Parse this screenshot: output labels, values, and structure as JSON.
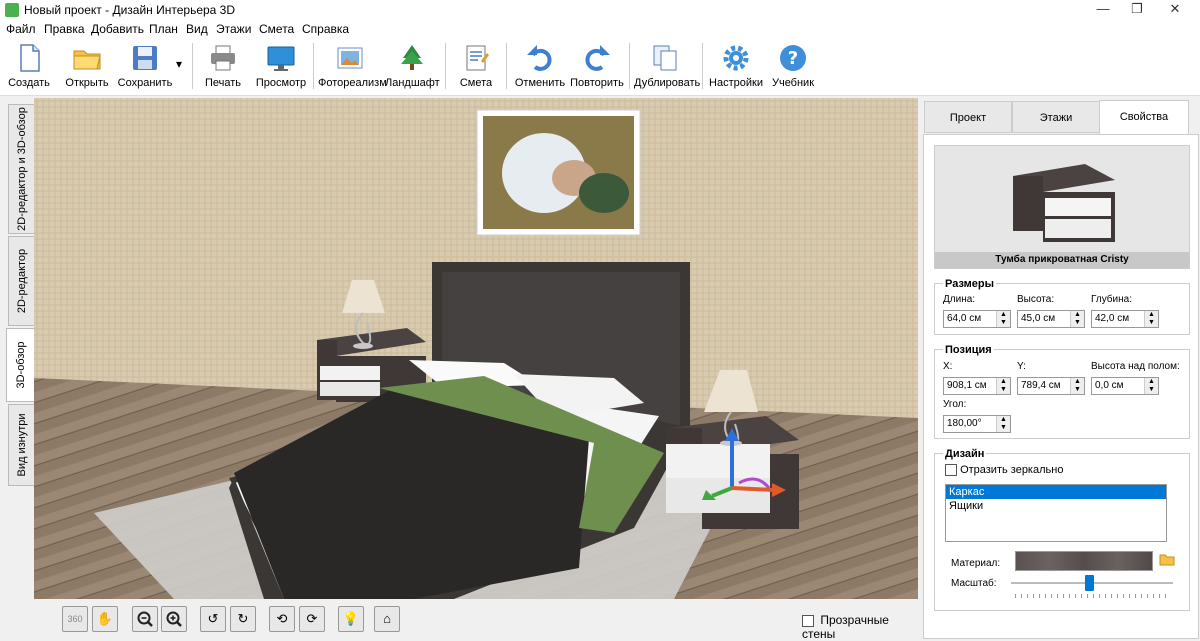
{
  "window": {
    "title": "Новый проект - Дизайн Интерьера 3D",
    "minimize": "—",
    "maximize": "❐",
    "close": "✕"
  },
  "menu": [
    "Файл",
    "Правка",
    "Добавить",
    "План",
    "Вид",
    "Этажи",
    "Смета",
    "Справка"
  ],
  "toolbar": {
    "create": "Создать",
    "open": "Открыть",
    "save": "Сохранить",
    "save_dropdown": "▾",
    "print": "Печать",
    "preview": "Просмотр",
    "photorealism": "Фотореализм",
    "landscape": "Ландшафт",
    "estimate": "Смета",
    "undo": "Отменить",
    "redo": "Повторить",
    "duplicate": "Дублировать",
    "settings": "Настройки",
    "tutorial": "Учебник"
  },
  "left_tabs": [
    "2D-редактор и 3D-обзор",
    "2D-редактор",
    "3D-обзор",
    "Вид изнутри"
  ],
  "left_tab_active": "3D-обзор",
  "bottom": {
    "rotate360": "360",
    "transparent_walls": "Прозрачные стены",
    "transparent_walls_checked": false
  },
  "right_tabs": [
    "Проект",
    "Этажи",
    "Свойства"
  ],
  "right_tab_active": "Свойства",
  "object": {
    "name": "Тумба прикроватная Cristy"
  },
  "sizes": {
    "title": "Размеры",
    "length_label": "Длина:",
    "length": "64,0 см",
    "height_label": "Высота:",
    "height": "45,0 см",
    "depth_label": "Глубина:",
    "depth": "42,0 см"
  },
  "position": {
    "title": "Позиция",
    "x_label": "X:",
    "x": "908,1 см",
    "y_label": "Y:",
    "y": "789,4 см",
    "floor_label": "Высота над полом:",
    "floor": "0,0 см",
    "angle_label": "Угол:",
    "angle": "180,00°"
  },
  "design": {
    "title": "Дизайн",
    "mirror_label": "Отразить зеркально",
    "mirror_checked": false,
    "parts": [
      "Каркас",
      "Ящики"
    ],
    "selected_part": "Каркас",
    "material_label": "Материал:",
    "scale_label": "Масштаб:",
    "scale_fraction": 0.48
  },
  "colors": {
    "accent": "#0078d7",
    "wall": "#d8cbb0",
    "bed": "#3b3735",
    "throw": "#6f8f4f"
  }
}
